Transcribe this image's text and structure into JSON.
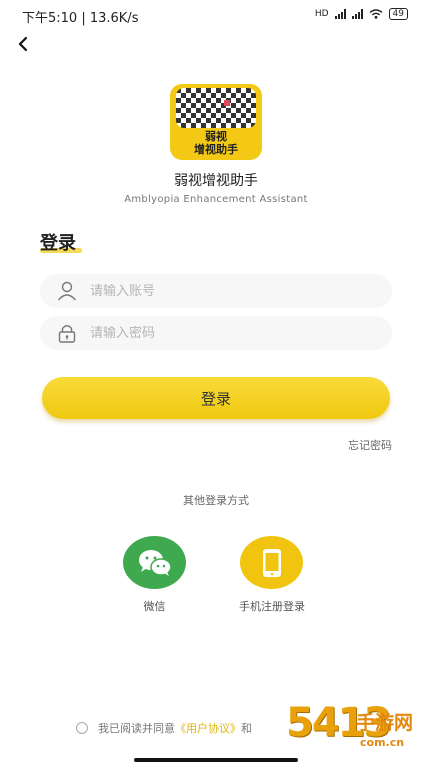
{
  "status_bar": {
    "time_speed": "下午5:10 | 13.6K/s",
    "network": "HD",
    "battery": "49"
  },
  "app": {
    "logo_text_line1": "弱视",
    "logo_text_line2": "增视助手",
    "name": "弱视增视助手",
    "subtitle": "Amblyopia Enhancement Assistant"
  },
  "login": {
    "heading": "登录",
    "account_placeholder": "请输入账号",
    "password_placeholder": "请输入密码",
    "button_label": "登录",
    "forgot_password": "忘记密码"
  },
  "other_login": {
    "title": "其他登录方式",
    "wechat_label": "微信",
    "phone_label": "手机注册登录"
  },
  "agreement": {
    "prefix": "我已阅读并同意",
    "user_agreement": "《用户协议》",
    "and": "和"
  },
  "watermark": {
    "number": "5413",
    "text": "手游网",
    "url": "com.cn"
  },
  "colors": {
    "accent": "#f3c915",
    "wechat_green": "#3fa94f",
    "field_bg": "#f7f7f7"
  }
}
